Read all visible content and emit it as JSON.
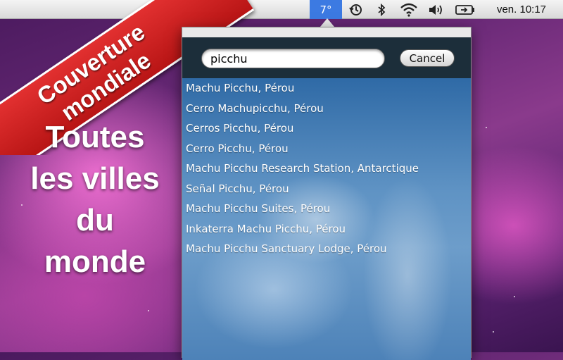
{
  "menubar": {
    "temperature": "7°",
    "clock": "ven. 10:17",
    "icons": [
      "time-machine-icon",
      "bluetooth-icon",
      "wifi-icon",
      "volume-icon",
      "battery-icon"
    ]
  },
  "promo": {
    "banner_line1": "Couverture",
    "banner_line2": "mondiale",
    "tagline_line1": "Toutes",
    "tagline_line2": "les villes",
    "tagline_line3": "du",
    "tagline_line4": "monde"
  },
  "search": {
    "query": "picchu",
    "cancel_label": "Cancel"
  },
  "results": [
    "Machu Picchu, Pérou",
    "Cerro Machupicchu, Pérou",
    "Cerros Picchu, Pérou",
    "Cerro Picchu, Pérou",
    "Machu Picchu Research Station, Antarctique",
    "Señal Picchu, Pérou",
    "Machu Picchu Suites, Pérou",
    "Inkaterra Machu Picchu, Pérou",
    "Machu Picchu Sanctuary Lodge, Pérou"
  ],
  "colors": {
    "menubar_highlight": "#3c7ae2",
    "banner_red": "#d02020",
    "header_dark": "#1c2e3a"
  }
}
